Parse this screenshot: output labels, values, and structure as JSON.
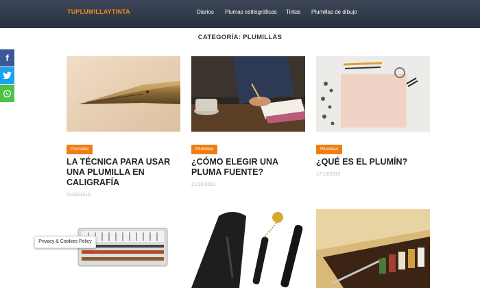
{
  "header": {
    "logo": "TUPLUMILLAYTINTA",
    "nav": [
      "Diarios",
      "Plumas estilográficas",
      "Tintas",
      "Plumillas de dibujo"
    ]
  },
  "category_title": "CATEGORÍA: PLUMILLAS",
  "share": {
    "facebook_icon": "f",
    "twitter_icon": "t",
    "whatsapp_icon": "w"
  },
  "posts": [
    {
      "badge": "Plumillas",
      "title": "LA TÉCNICA PARA USAR UNA PLUMILLA EN CALIGRAFÍA",
      "date": "21/10/2019",
      "image": "pen-nib-photo"
    },
    {
      "badge": "Plumillas",
      "title": "¿CÓMO ELEGIR UNA PLUMA FUENTE?",
      "date": "21/10/2019",
      "image": "writing-desk-photo"
    },
    {
      "badge": "Plumillas",
      "title": "¿QUÉ ES EL PLUMÍN?",
      "date": "17/10/2019",
      "image": "paper-and-pens-photo"
    },
    {
      "image": "nib-set-box-photo"
    },
    {
      "image": "fountain-pen-case-photo"
    },
    {
      "image": "wooden-calligraphy-set-photo"
    }
  ],
  "cookie_notice": "Privacy & Cookies Policy",
  "colors": {
    "topbar": "#323a48",
    "logo": "#f08a1e",
    "badge": "#f07d12"
  }
}
